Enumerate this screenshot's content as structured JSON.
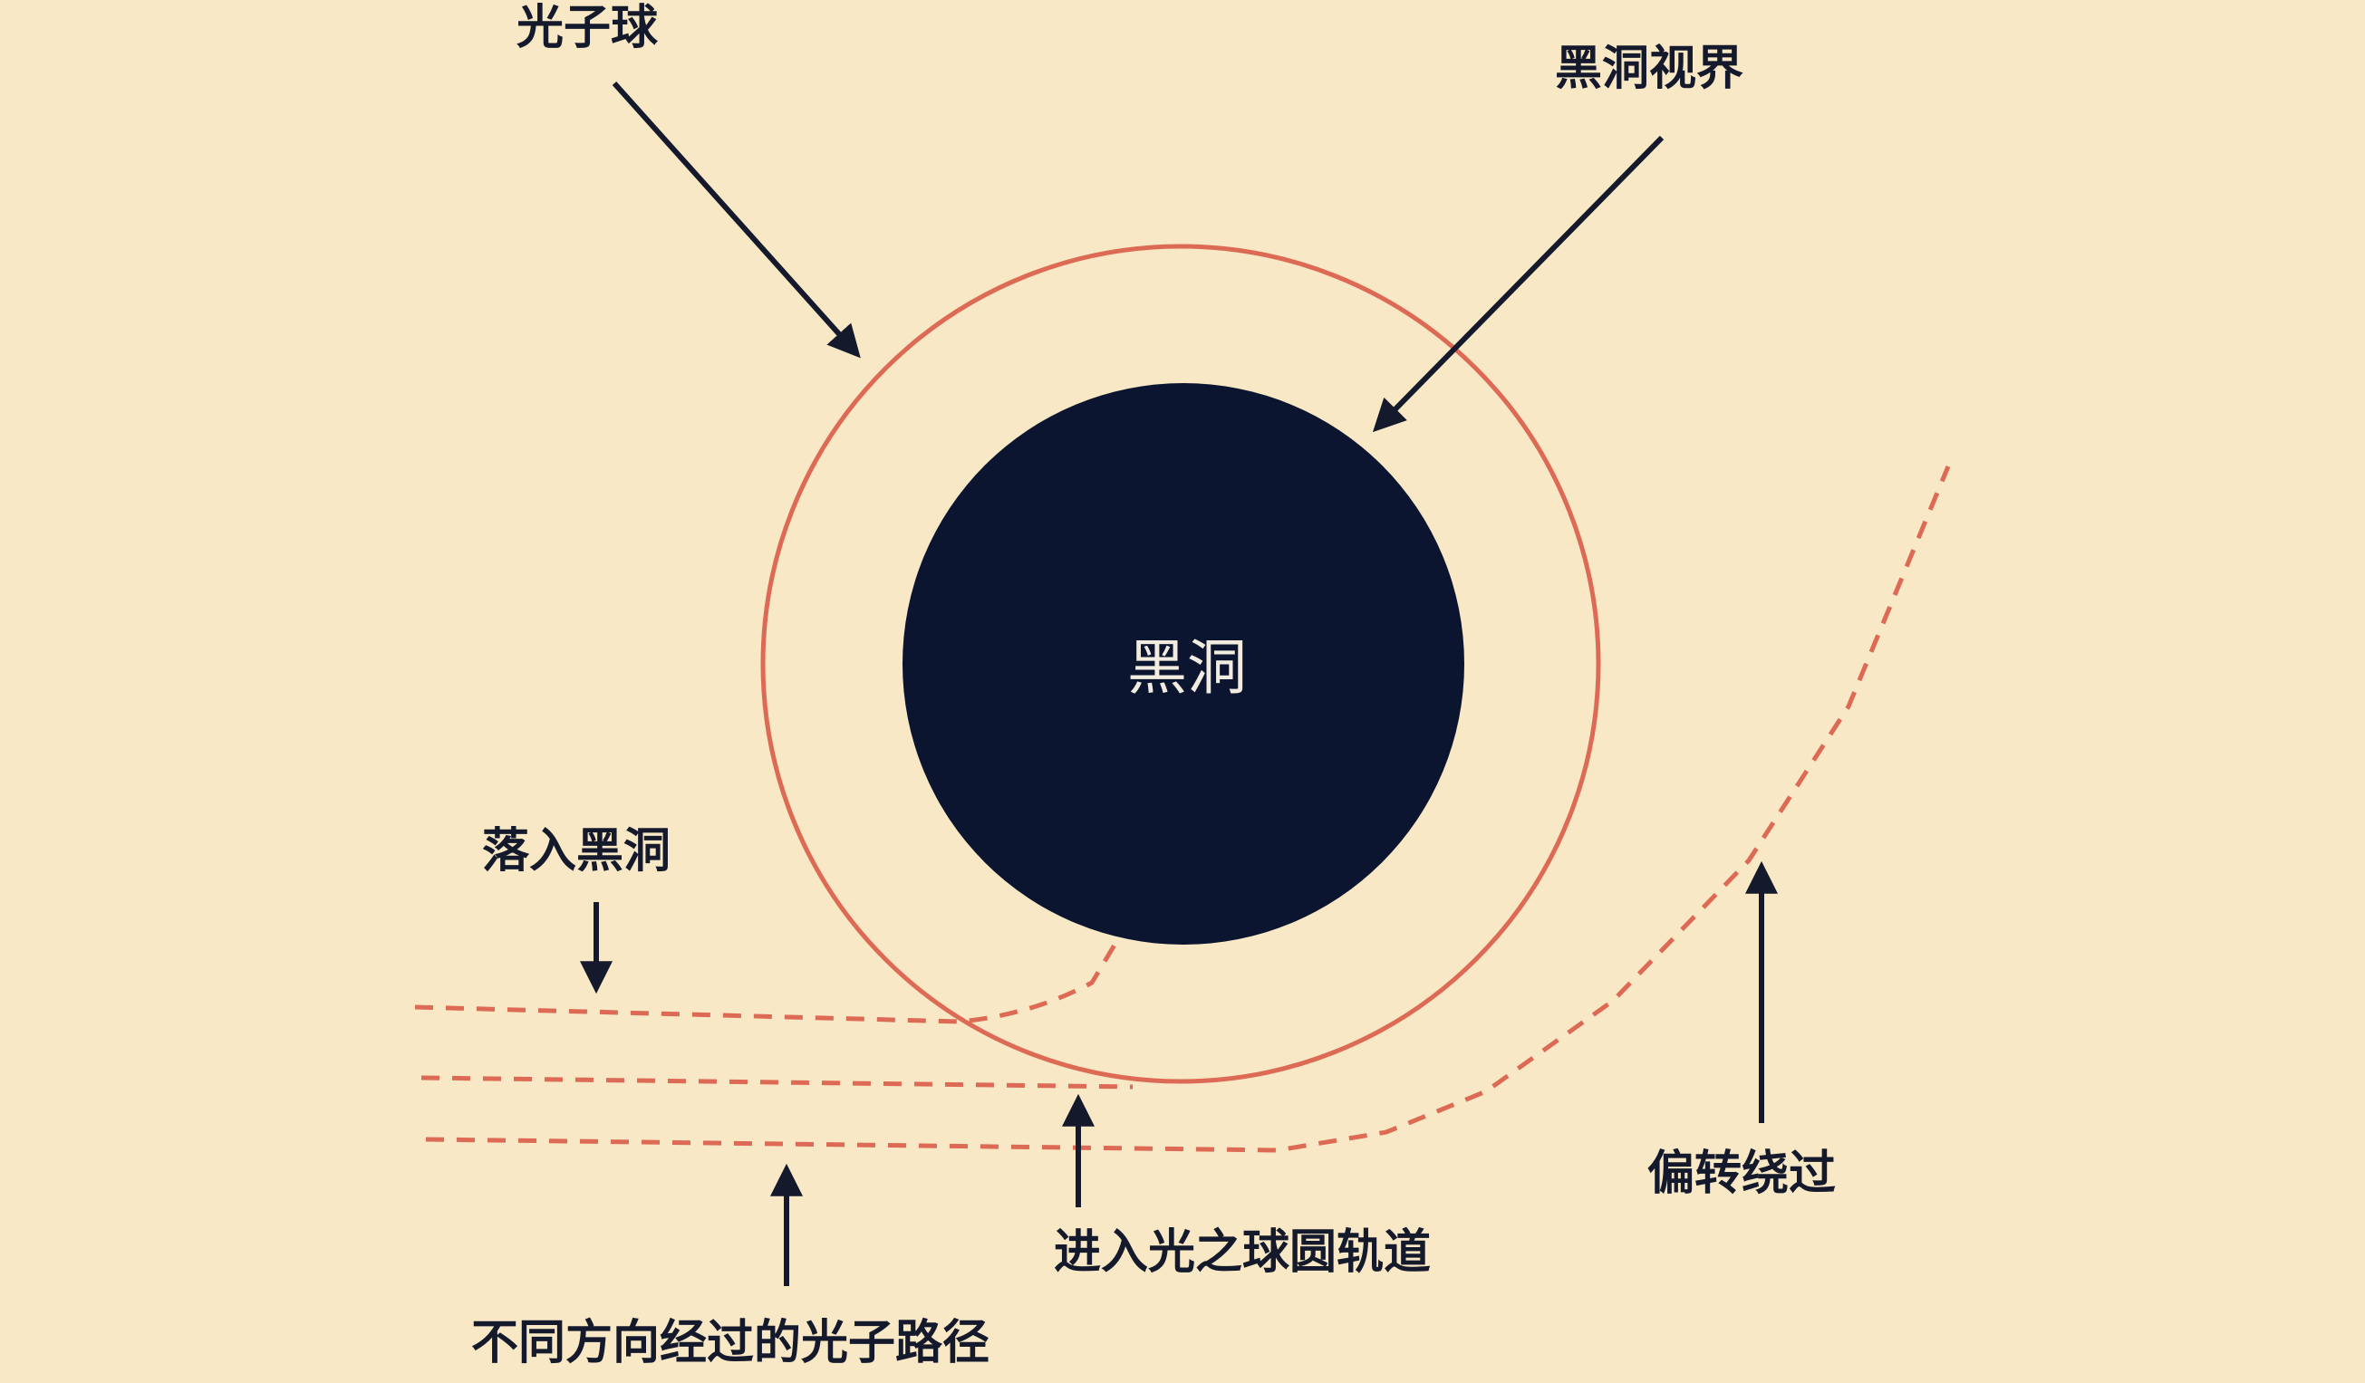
{
  "diagram": {
    "black_hole_label": "黑洞",
    "photon_sphere_label": "光子球",
    "event_horizon_label": "黑洞视界",
    "fall_in_label": "落入黑洞",
    "orbit_label": "进入光之球圆轨道",
    "deflect_label": "偏转绕过",
    "paths_label": "不同方向经过的光子路径"
  },
  "colors": {
    "background": "#f8e8c6",
    "black_hole": "#0c1530",
    "photon_sphere": "#dd6a55",
    "photon_paths": "#dd6a55",
    "arrows": "#141a2c"
  }
}
